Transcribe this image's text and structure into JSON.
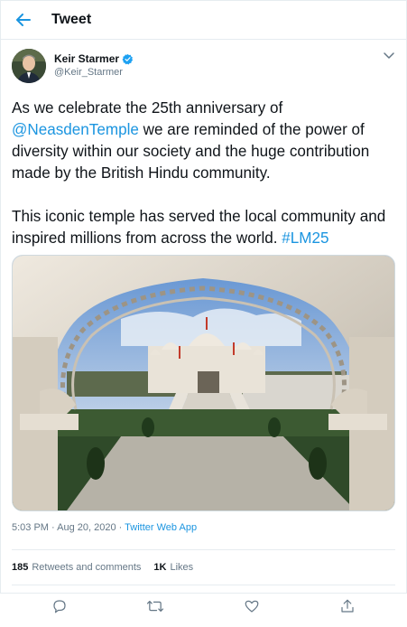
{
  "header": {
    "title": "Tweet"
  },
  "author": {
    "name": "Keir Starmer",
    "handle": "@Keir_Starmer"
  },
  "tweet": {
    "para1_part1": "As we celebrate the 25th anniversary of",
    "mention": "@NeasdenTemple",
    "para1_part2": " we are reminded of the power of diversity within our society and the huge contribution made by the British Hindu community.",
    "para2_part1": "This iconic temple has served the local community and inspired millions from across the world. ",
    "hashtag": "#LM25"
  },
  "meta": {
    "time": "5:03 PM",
    "separator1": " · ",
    "date": "Aug 20, 2020",
    "separator2": " · ",
    "app": "Twitter Web App"
  },
  "stats": {
    "retweets_count": "185",
    "retweets_label": "Retweets and comments",
    "likes_count": "1K",
    "likes_label": "Likes"
  },
  "colors": {
    "accent": "#1b95e0",
    "muted": "#657786",
    "border": "#e6ecf0"
  },
  "icons": [
    "back-arrow-icon",
    "verified-badge-icon",
    "chevron-down-icon",
    "reply-icon",
    "retweet-icon",
    "like-icon",
    "share-icon"
  ]
}
